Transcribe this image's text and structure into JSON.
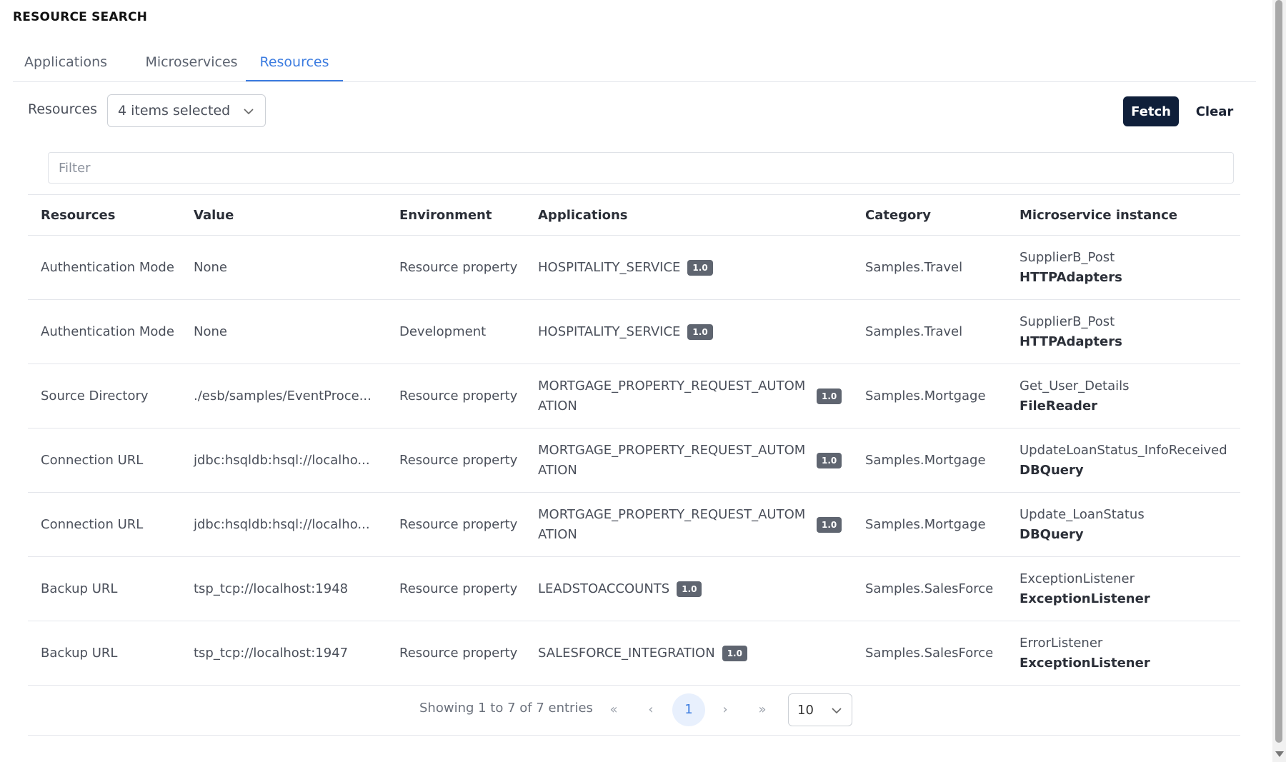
{
  "page": {
    "title": "RESOURCE SEARCH"
  },
  "tabs": [
    {
      "label": "Applications",
      "active": false
    },
    {
      "label": "Microservices",
      "active": false
    },
    {
      "label": "Resources",
      "active": true
    }
  ],
  "toolbar": {
    "resources_label": "Resources",
    "resources_select_value": "4 items selected",
    "fetch_label": "Fetch",
    "clear_label": "Clear"
  },
  "filter": {
    "placeholder": "Filter",
    "value": ""
  },
  "table": {
    "headers": [
      "Resources",
      "Value",
      "Environment",
      "Applications",
      "Category",
      "Microservice instance"
    ],
    "rows": [
      {
        "resource": "Authentication Mode",
        "value": "None",
        "environment": "Resource property",
        "application": "HOSPITALITY_SERVICE",
        "version": "1.0",
        "category": "Samples.Travel",
        "ms_name": "SupplierB_Post",
        "ms_type": "HTTPAdapters"
      },
      {
        "resource": "Authentication Mode",
        "value": "None",
        "environment": "Development",
        "application": "HOSPITALITY_SERVICE",
        "version": "1.0",
        "category": "Samples.Travel",
        "ms_name": "SupplierB_Post",
        "ms_type": "HTTPAdapters"
      },
      {
        "resource": "Source Directory",
        "value": "./esb/samples/EventProce...",
        "environment": "Resource property",
        "application": "MORTGAGE_PROPERTY_REQUEST_AUTOMATION",
        "version": "1.0",
        "category": "Samples.Mortgage",
        "ms_name": "Get_User_Details",
        "ms_type": "FileReader"
      },
      {
        "resource": "Connection URL",
        "value": "jdbc:hsqldb:hsql://localho...",
        "environment": "Resource property",
        "application": "MORTGAGE_PROPERTY_REQUEST_AUTOMATION",
        "version": "1.0",
        "category": "Samples.Mortgage",
        "ms_name": "UpdateLoanStatus_InfoReceived",
        "ms_type": "DBQuery"
      },
      {
        "resource": "Connection URL",
        "value": "jdbc:hsqldb:hsql://localho...",
        "environment": "Resource property",
        "application": "MORTGAGE_PROPERTY_REQUEST_AUTOMATION",
        "version": "1.0",
        "category": "Samples.Mortgage",
        "ms_name": "Update_LoanStatus",
        "ms_type": "DBQuery"
      },
      {
        "resource": "Backup URL",
        "value": "tsp_tcp://localhost:1948",
        "environment": "Resource property",
        "application": "LEADSTOACCOUNTS",
        "version": "1.0",
        "category": "Samples.SalesForce",
        "ms_name": "ExceptionListener",
        "ms_type": "ExceptionListener"
      },
      {
        "resource": "Backup URL",
        "value": "tsp_tcp://localhost:1947",
        "environment": "Resource property",
        "application": "SALESFORCE_INTEGRATION",
        "version": "1.0",
        "category": "Samples.SalesForce",
        "ms_name": "ErrorListener",
        "ms_type": "ExceptionListener"
      }
    ]
  },
  "pagination": {
    "info": "Showing 1 to 7 of 7 entries",
    "first": "«",
    "prev": "‹",
    "current_page": "1",
    "next": "›",
    "last": "»",
    "page_size": "10"
  },
  "icons": {
    "select_chevron": "chevron-down-icon",
    "page_size_chevron": "chevron-down-icon"
  },
  "colors": {
    "accent": "#3c7ce0",
    "primary_button": "#0f1f3a",
    "badge": "#5f6570"
  }
}
